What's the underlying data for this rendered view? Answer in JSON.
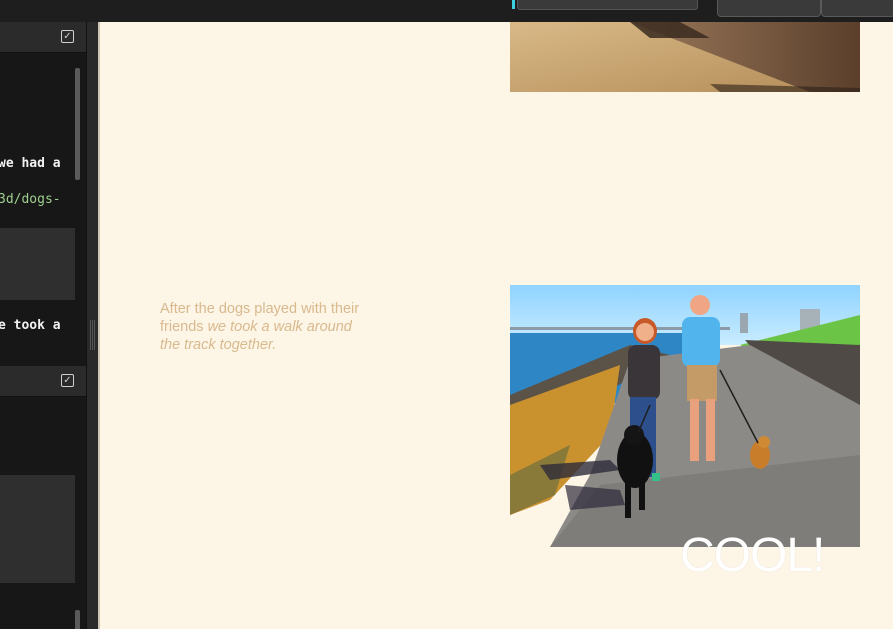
{
  "editor": {
    "lines": [
      "we had a",
      "3d/dogs-",
      "e took a"
    ]
  },
  "preview": {
    "caption_plain": "After the dogs played with their friends ",
    "caption_italic": "we took a walk around the track together.",
    "overlay_text": "COOL!",
    "photo_top_alt": "sandy ground with a concrete wall",
    "photo_main_alt": "couple walking two dogs on a paved track by the water"
  },
  "colors": {
    "preview_bg": "#fdf5e6",
    "caption": "#d9b98e",
    "editor_bg": "#171717",
    "code_link": "#9fcf8f",
    "accent": "#3fd0e0"
  }
}
